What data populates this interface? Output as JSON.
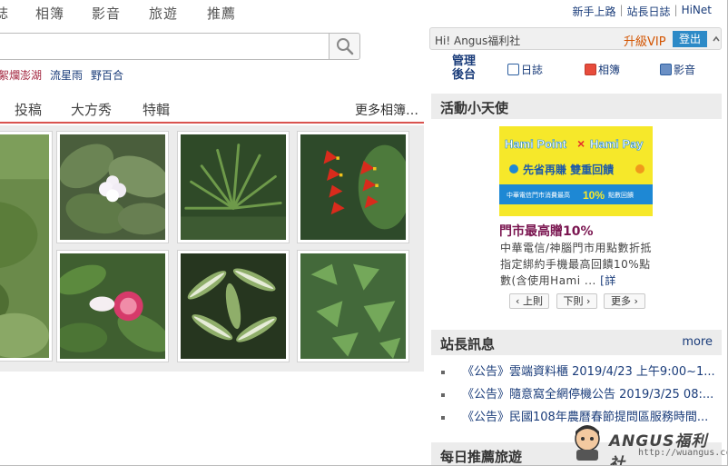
{
  "nav": {
    "items": [
      "誌",
      "相簿",
      "影音",
      "旅遊",
      "推薦"
    ],
    "links": [
      "新手上路",
      "站長日誌",
      "HiNet"
    ]
  },
  "search": {
    "placeholder": ""
  },
  "hot_tags": [
    "絮爛澎湖",
    "流星雨",
    "野百合"
  ],
  "tabs": {
    "items": [
      "投稿",
      "大方秀",
      "特輯"
    ],
    "more": "更多相簿…"
  },
  "gallery": {
    "thumbs": [
      "plant-partial",
      "white-flower-leaves",
      "palm-fronds",
      "red-heliconia",
      "pink-flower",
      "variegated-leaves",
      "green-vines"
    ]
  },
  "user": {
    "greeting": "Hi! Angus福利社",
    "vip": "升級VIP",
    "logout": "登出"
  },
  "quick": {
    "manage_line1": "管理",
    "manage_line2": "後台",
    "blog": "日誌",
    "album": "相簿",
    "video": "影音"
  },
  "angel": {
    "title": "活動小天使",
    "ad": {
      "brand1": "Hami Point",
      "x": "×",
      "brand2": "Hami Pay",
      "line1": "先省再賺 雙重回饋",
      "line2a": "中華電信門市消費最高",
      "pct": "10%",
      "line2b": "點數回饋"
    },
    "promo_title": "門市最高贈10%",
    "promo_desc": "中華電信/神腦門市用點數折抵指定綁約手機最高回饋10%點數(含使用Hami ...",
    "detail": "[詳",
    "prev": "‹ 上則",
    "next": "下則 ›",
    "more": "更多 ›"
  },
  "news": {
    "title": "站長訊息",
    "more": "more",
    "items": [
      "《公告》雲端資料櫃 2019/4/23 上午9:00~1...",
      "《公告》隨意窩全網停機公告 2019/3/25 08:...",
      "《公告》民國108年農曆春節提問區服務時間..."
    ]
  },
  "daily": {
    "title": "每日推薦旅遊"
  },
  "watermark": {
    "text": "ANGUS福利社",
    "url": "http://wuangus.cc"
  },
  "colors": {
    "accent_red": "#d9534f",
    "link_blue": "#1a3c7a",
    "logout_blue": "#2d8ac7",
    "vip_orange": "#d35400"
  }
}
